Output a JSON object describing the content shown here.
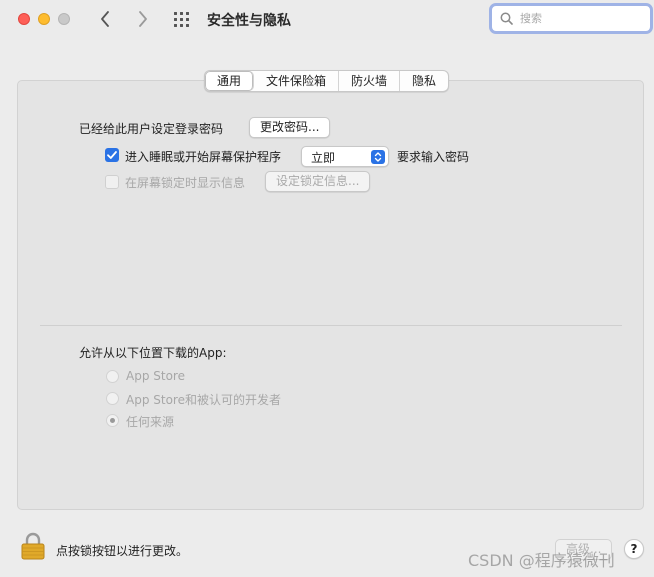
{
  "window": {
    "title": "安全性与隐私"
  },
  "search": {
    "placeholder": "搜索"
  },
  "tabs": [
    {
      "label": "通用",
      "active": true
    },
    {
      "label": "文件保险箱",
      "active": false
    },
    {
      "label": "防火墙",
      "active": false
    },
    {
      "label": "隐私",
      "active": false
    }
  ],
  "general": {
    "password_set_label": "已经给此用户设定登录密码",
    "change_password_button": "更改密码...",
    "require_password": {
      "checked": true,
      "label": "进入睡眠或开始屏幕保护程序",
      "select_value": "立即",
      "suffix": "要求输入密码"
    },
    "show_message": {
      "checked": false,
      "label": "在屏幕锁定时显示信息",
      "button": "设定锁定信息..."
    }
  },
  "downloads": {
    "title": "允许从以下位置下载的App:",
    "options": [
      {
        "label": "App Store",
        "selected": false
      },
      {
        "label": "App Store和被认可的开发者",
        "selected": false
      },
      {
        "label": "任何来源",
        "selected": true
      }
    ]
  },
  "footer": {
    "lock_text": "点按锁按钮以进行更改。",
    "advanced_button": "高级...",
    "help_button": "?"
  },
  "watermark": "CSDN @程序猿微刊",
  "colors": {
    "accent": "#2a72e5",
    "close": "#fe5f57",
    "minimize": "#febc2e",
    "zoom": "#c9c9c9",
    "lock": "#d9a21f"
  }
}
